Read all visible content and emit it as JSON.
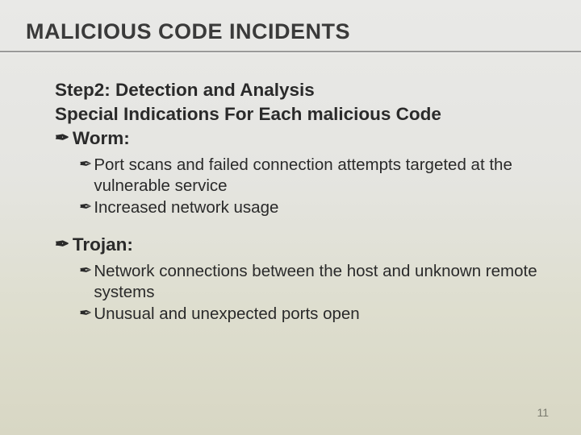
{
  "title": "MALICIOUS CODE INCIDENTS",
  "heading1": "Step2: Detection and Analysis",
  "heading2": "Special Indications For Each malicious Code",
  "bullet_glyph": "✒",
  "sections": {
    "worm": {
      "label": "Worm:",
      "items": [
        "Port scans and failed connection attempts targeted at the vulnerable service",
        " Increased network usage"
      ]
    },
    "trojan": {
      "label": "Trojan:",
      "items": [
        "Network connections between the host and unknown remote systems",
        "Unusual and unexpected ports open"
      ]
    }
  },
  "page_number": "11"
}
